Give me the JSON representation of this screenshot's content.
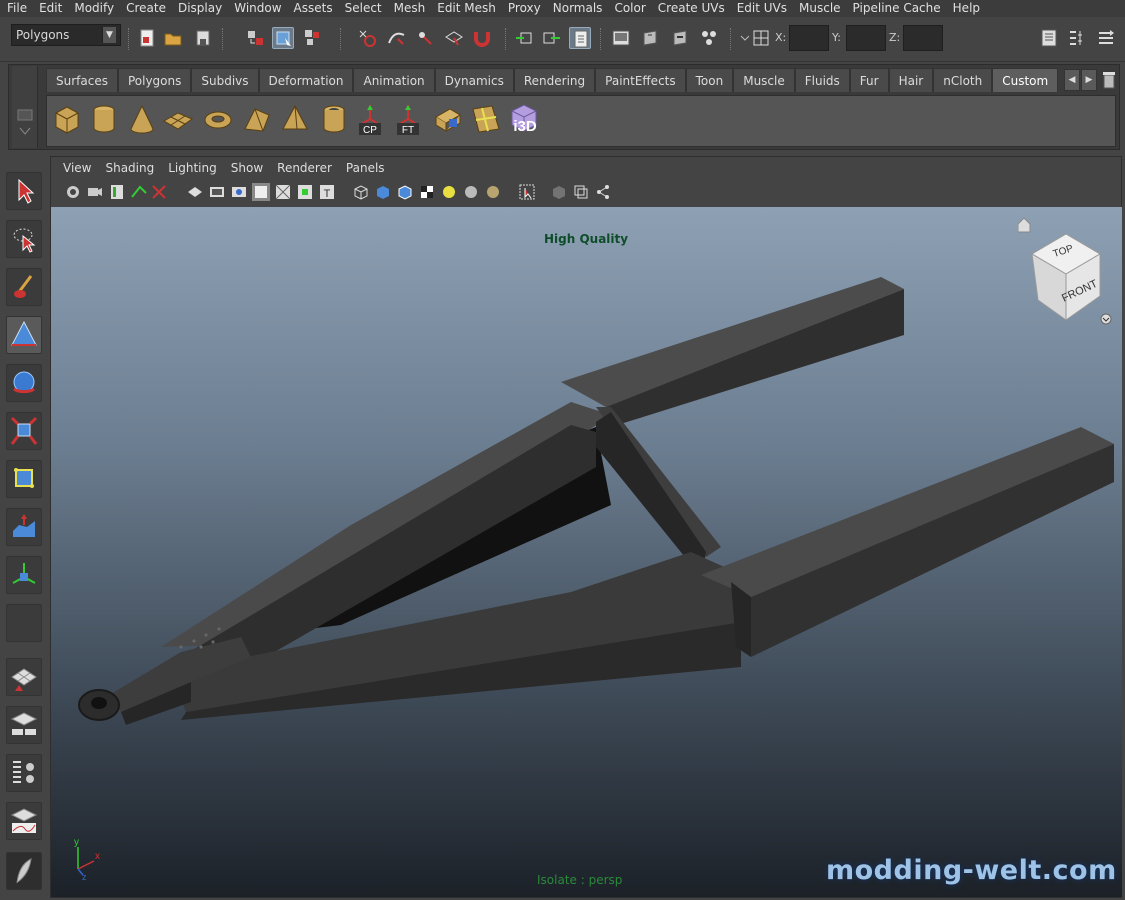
{
  "menubar": {
    "items": [
      "File",
      "Edit",
      "Modify",
      "Create",
      "Display",
      "Window",
      "Assets",
      "Select",
      "Mesh",
      "Edit Mesh",
      "Proxy",
      "Normals",
      "Color",
      "Create UVs",
      "Edit UVs",
      "Muscle",
      "Pipeline Cache",
      "Help"
    ]
  },
  "statusline": {
    "mode": "Polygons",
    "x_label": "X:",
    "y_label": "Y:",
    "z_label": "Z:"
  },
  "shelf": {
    "tabs": [
      "Surfaces",
      "Polygons",
      "Subdivs",
      "Deformation",
      "Animation",
      "Dynamics",
      "Rendering",
      "PaintEffects",
      "Toon",
      "Muscle",
      "Fluids",
      "Fur",
      "Hair",
      "nCloth",
      "Custom"
    ],
    "active_tab": "Custom",
    "icons": [
      "poly-cube-icon",
      "poly-cylinder-icon",
      "poly-cone-icon",
      "poly-plane-icon",
      "poly-torus-icon",
      "poly-prism-icon",
      "poly-pyramid-icon",
      "poly-pipe-icon",
      "center-pivot-icon",
      "freeze-transforms-icon",
      "uv-map-icon",
      "uv-editor-icon",
      "i3d-export-icon"
    ],
    "icon_labels": {
      "cp": "CP",
      "ft": "FT",
      "i3d": "i3D"
    }
  },
  "panel": {
    "menu": [
      "View",
      "Shading",
      "Lighting",
      "Show",
      "Renderer",
      "Panels"
    ]
  },
  "viewport": {
    "quality_label": "High Quality",
    "isolate_label": "Isolate : persp",
    "watermark": "modding-welt.com",
    "viewcube_top": "TOP",
    "viewcube_front": "FRONT",
    "axis_x": "x",
    "axis_y": "y",
    "axis_z": "z"
  },
  "colors": {
    "menu_bg": "#3c3c3c",
    "ui_bg": "#444444",
    "viewport_top": "#8ea0b3",
    "viewport_bottom": "#1c2128",
    "quality_text": "#0e4d2a",
    "watermark": "#9ec3e6",
    "model": "#3a3a3a"
  }
}
